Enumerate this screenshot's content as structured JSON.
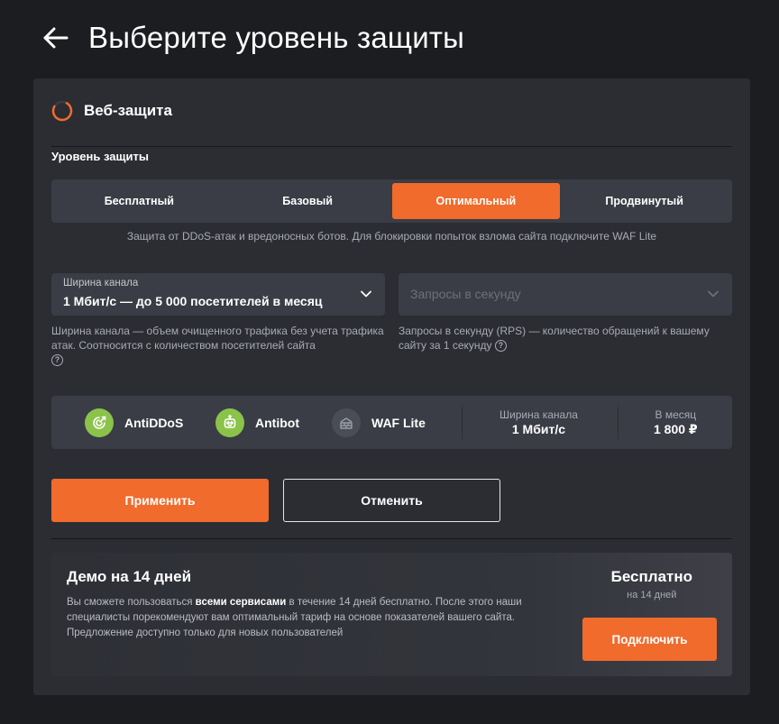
{
  "page": {
    "title": "Выберите уровень защиты"
  },
  "section": {
    "title": "Веб-защита"
  },
  "protection": {
    "label": "Уровень защиты",
    "tabs": [
      {
        "label": "Бесплатный",
        "active": false
      },
      {
        "label": "Базовый",
        "active": false
      },
      {
        "label": "Оптимальный",
        "active": true
      },
      {
        "label": "Продвинутый",
        "active": false
      }
    ],
    "description": "Защита от DDoS-атак и вредоносных ботов. Для блокировки попыток взлома сайта подключите WAF Lite"
  },
  "bandwidth": {
    "label": "Ширина канала",
    "value": "1 Мбит/с — до 5 000 посетителей в месяц",
    "help": "Ширина канала — объем очищенного трафика без учета трафика атак. Соотносится с количеством посетителей сайта"
  },
  "rps": {
    "placeholder": "Запросы в секунду",
    "help": "Запросы в секунду (RPS) — количество обращений к вашему сайту за 1 секунду"
  },
  "summary": {
    "features": [
      {
        "name": "AntiDDoS",
        "icon": "antiddos-icon",
        "enabled": true
      },
      {
        "name": "Antibot",
        "icon": "robot-icon",
        "enabled": true
      },
      {
        "name": "WAF Lite",
        "icon": "firewall-icon",
        "enabled": false
      }
    ],
    "bandwidth_label": "Ширина канала",
    "bandwidth_value": "1 Мбит/с",
    "price_label": "В месяц",
    "price_value": "1 800 ₽"
  },
  "actions": {
    "apply": "Применить",
    "cancel": "Отменить"
  },
  "demo": {
    "title": "Демо на 14 дней",
    "text_before": "Вы сможете пользоваться ",
    "text_bold": "всеми сервисами",
    "text_after": " в течение 14 дней бесплатно. После этого наши специалисты порекомендуют вам оптимальный тариф на основе показателей вашего сайта. Предложение доступно только для новых пользователей",
    "price": "Бесплатно",
    "price_sub": "на 14 дней",
    "connect": "Подключить"
  },
  "colors": {
    "accent": "#f06b2c",
    "feature_enabled": "#8bc34a",
    "background": "#1c1d21",
    "card": "#2b2d33"
  }
}
